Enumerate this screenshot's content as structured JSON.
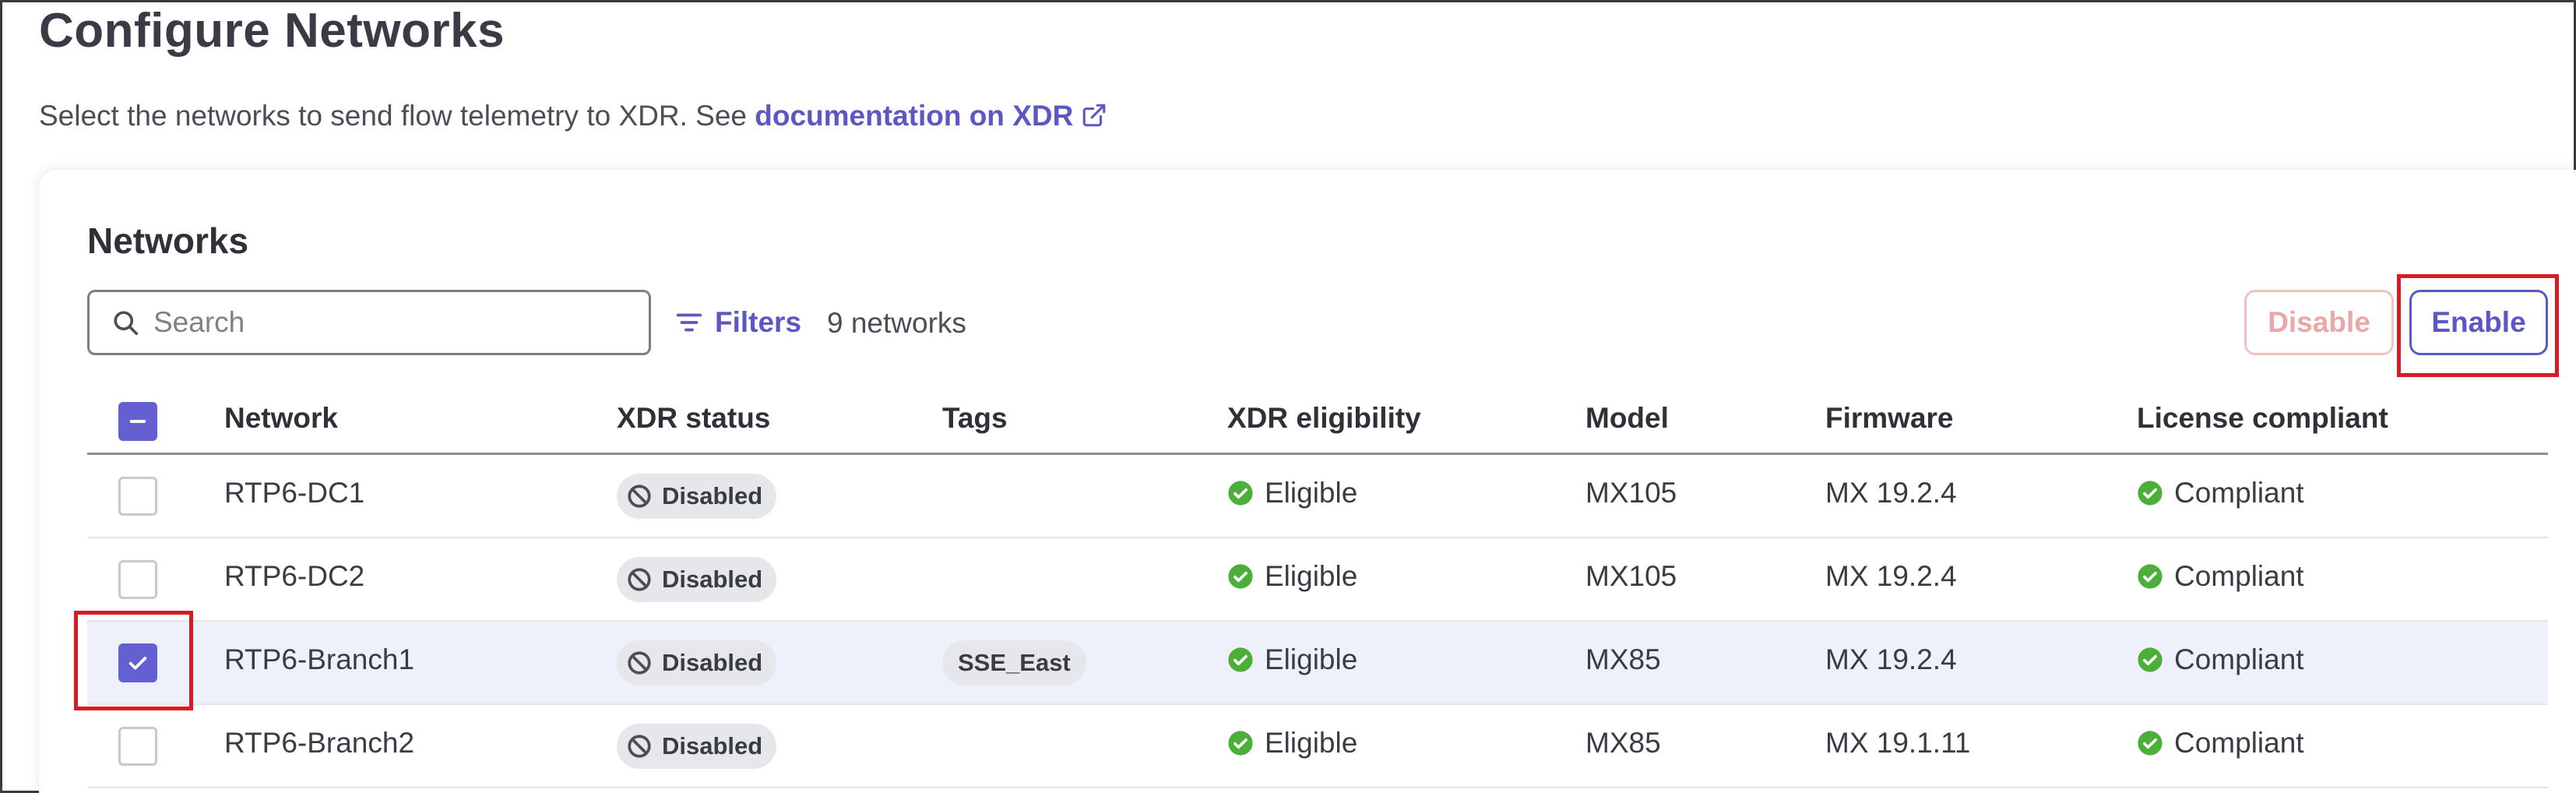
{
  "page": {
    "title": "Configure Networks",
    "subtitle_text": "Select the networks to send flow telemetry to XDR. See ",
    "doc_link": "documentation on XDR"
  },
  "networks": {
    "title": "Networks",
    "search_placeholder": "Search",
    "filters_label": "Filters",
    "count": "9 networks",
    "disable_label": "Disable",
    "enable_label": "Enable"
  },
  "table": {
    "columns": [
      "Network",
      "XDR status",
      "Tags",
      "XDR eligibility",
      "Model",
      "Firmware",
      "License compliant"
    ],
    "rows": [
      {
        "network": "RTP6-DC1",
        "status": "Disabled",
        "tag": "",
        "eligibility": "Eligible",
        "model": "MX105",
        "firmware": "MX 19.2.4",
        "license": "Compliant",
        "checked": false
      },
      {
        "network": "RTP6-DC2",
        "status": "Disabled",
        "tag": "",
        "eligibility": "Eligible",
        "model": "MX105",
        "firmware": "MX 19.2.4",
        "license": "Compliant",
        "checked": false
      },
      {
        "network": "RTP6-Branch1",
        "status": "Disabled",
        "tag": "SSE_East",
        "eligibility": "Eligible",
        "model": "MX85",
        "firmware": "MX 19.2.4",
        "license": "Compliant",
        "checked": true
      },
      {
        "network": "RTP6-Branch2",
        "status": "Disabled",
        "tag": "",
        "eligibility": "Eligible",
        "model": "MX85",
        "firmware": "MX 19.1.11",
        "license": "Compliant",
        "checked": false
      }
    ]
  },
  "colors": {
    "accent": "#5b57c4",
    "success": "#4caf3a",
    "highlight": "#d81b23"
  }
}
